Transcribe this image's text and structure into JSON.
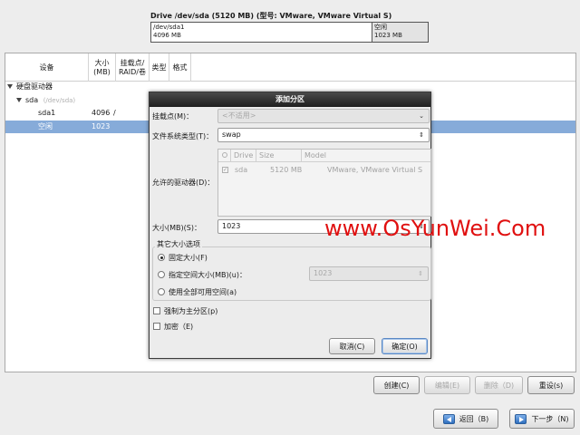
{
  "disk": {
    "title": "Drive /dev/sda (5120 MB) (型号: VMware, VMware Virtual S)",
    "segments": [
      {
        "line1": "/dev/sda1",
        "line2": "4096 MB"
      },
      {
        "line1": "空闲",
        "line2": "1023 MB"
      }
    ]
  },
  "tree": {
    "columns": {
      "device": "设备",
      "size": "大小\n(MB)",
      "mount": "挂载点/\nRAID/卷",
      "type": "类型",
      "format": "格式"
    },
    "rows": {
      "group": "硬盘驱动器",
      "disk_name": "sda",
      "disk_path": "(/dev/sda)",
      "part_name": "sda1",
      "part_size": "4096",
      "part_mount": "/",
      "free_name": "空闲",
      "free_size": "1023"
    }
  },
  "buttons": {
    "create": "创建(C)",
    "edit": "编辑(E)",
    "delete": "删除（D)",
    "reset": "重设(s)",
    "back": "返回（B)",
    "next": "下一步（N)"
  },
  "dialog": {
    "title": "添加分区",
    "mount_label": "挂载点(M)：",
    "mount_value": "<不适用>",
    "fstype_label": "文件系统类型(T)：",
    "fstype_value": "swap",
    "drives_label": "允许的驱动器(D)：",
    "drive_head": {
      "drive": "Drive",
      "size": "Size",
      "model": "Model"
    },
    "drive_row": {
      "drive": "sda",
      "size": "5120 MB",
      "model": "VMware, VMware Virtual S"
    },
    "size_label": "大小(MB)(S)：",
    "size_value": "1023",
    "other_options": "其它大小选项",
    "opt_fixed": "固定大小(F)",
    "opt_upto": "指定空间大小(MB)(u)：",
    "opt_upto_value": "1023",
    "opt_fill": "使用全部可用空间(a)",
    "force_primary": "强制为主分区(p)",
    "encrypt": "加密（E)",
    "cancel": "取消(C)",
    "ok": "确定(O)"
  },
  "watermark": "www.OsYunWei.Com",
  "colors": {
    "selection": "#86abd9",
    "watermark": "#e01010",
    "title_bar": "#2b2b2b"
  }
}
